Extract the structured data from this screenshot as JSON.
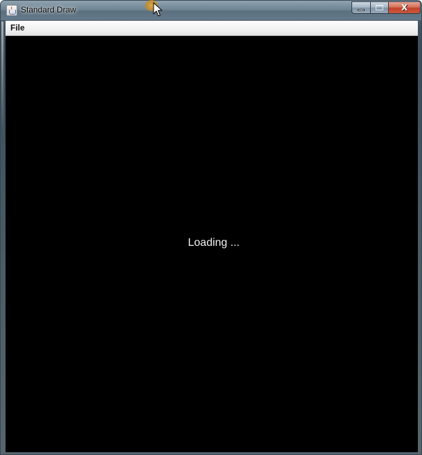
{
  "window": {
    "title": "Standard Draw",
    "title_icon": "java-icon",
    "controls": {
      "minimize_icon": "minimize-icon",
      "maximize_icon": "maximize-icon",
      "close_label": "X"
    }
  },
  "menubar": {
    "items": [
      {
        "label": "File"
      }
    ]
  },
  "canvas": {
    "background": "#000000",
    "message": "Loading ..."
  }
}
